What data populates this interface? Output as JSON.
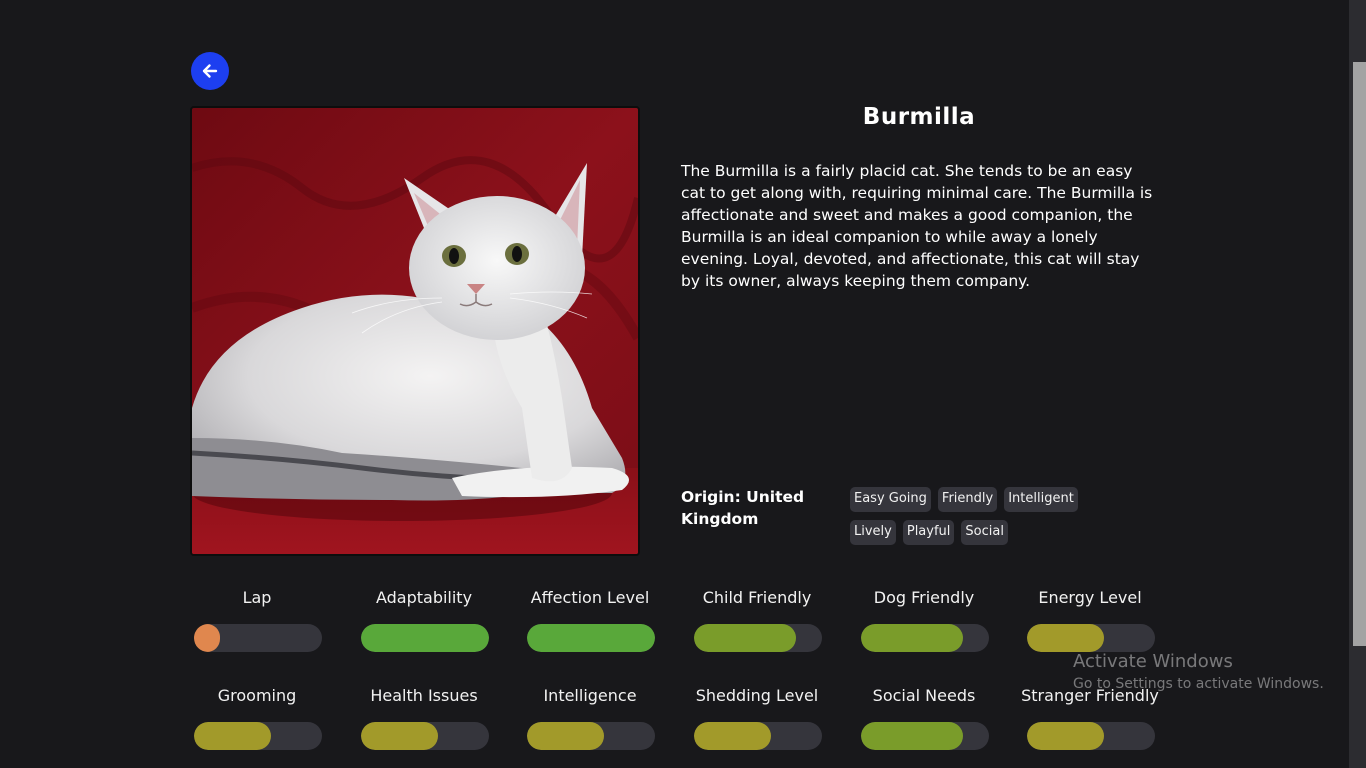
{
  "cat": {
    "name": "Burmilla",
    "description": "The Burmilla is a fairly placid cat. She tends to be an easy cat to get along with, requiring minimal care. The Burmilla is affectionate and sweet and makes a good companion, the Burmilla is an ideal companion to while away a lonely evening. Loyal, devoted, and affectionate, this cat will stay by its owner, always keeping them company.",
    "origin": "Origin: United Kingdom",
    "temperament": [
      "Easy Going",
      "Friendly",
      "Intelligent",
      "Lively",
      "Playful",
      "Social"
    ]
  },
  "stats": [
    {
      "label": "Lap",
      "value": 1,
      "max": 5,
      "color": "#e0874e"
    },
    {
      "label": "Adaptability",
      "value": 5,
      "max": 5,
      "color": "#59a83a"
    },
    {
      "label": "Affection Level",
      "value": 5,
      "max": 5,
      "color": "#59a83a"
    },
    {
      "label": "Child Friendly",
      "value": 4,
      "max": 5,
      "color": "#7a9c2a"
    },
    {
      "label": "Dog Friendly",
      "value": 4,
      "max": 5,
      "color": "#7a9c2a"
    },
    {
      "label": "Energy Level",
      "value": 3,
      "max": 5,
      "color": "#a29a2a"
    },
    {
      "label": "Grooming",
      "value": 3,
      "max": 5,
      "color": "#a29a2a"
    },
    {
      "label": "Health Issues",
      "value": 3,
      "max": 5,
      "color": "#a29a2a"
    },
    {
      "label": "Intelligence",
      "value": 3,
      "max": 5,
      "color": "#a29a2a"
    },
    {
      "label": "Shedding Level",
      "value": 3,
      "max": 5,
      "color": "#a29a2a"
    },
    {
      "label": "Social Needs",
      "value": 4,
      "max": 5,
      "color": "#7a9c2a"
    },
    {
      "label": "Stranger Friendly",
      "value": 3,
      "max": 5,
      "color": "#a29a2a"
    }
  ],
  "watermark": {
    "title": "Activate Windows",
    "subtitle": "Go to Settings to activate Windows."
  },
  "icons": {
    "back": "arrow-left-icon"
  }
}
